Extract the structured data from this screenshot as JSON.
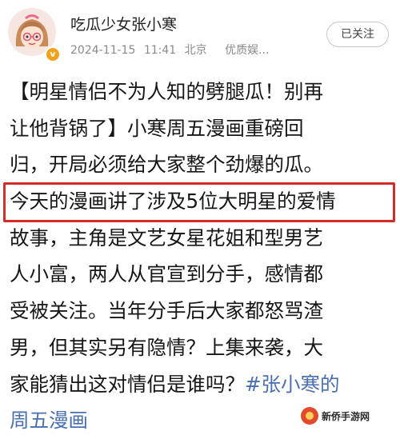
{
  "header": {
    "username": "吃瓜少女张小寒",
    "date": "2024-11-15",
    "time": "11:41",
    "location": "北京",
    "source": "优质娱...",
    "follow_label": "已关注",
    "verified_badge": "v"
  },
  "post": {
    "lines": [
      "【明星情侣不为人知的劈腿瓜！别再",
      "让他背锅了】小寒周五漫画重磅回",
      "归，开局必须给大家整个劲爆的瓜。",
      "今天的漫画讲了涉及5位大明星的爱情",
      "故事，主角是文艺女星花姐和型男艺",
      "人小富，两人从官宣到分手，感情都",
      "受被关注。当年分手后大家都怒骂渣",
      "男，但其实另有隐情？上集来袭，大",
      "家能猜出这对情侣是谁吗？",
      "周五漫画"
    ],
    "hashtag": "#张小寒的"
  },
  "watermark": {
    "text": "新侨手游网"
  },
  "colors": {
    "highlight": "#d32a2a",
    "hashtag": "#4a6fb0",
    "badge": "#f2a21a"
  }
}
